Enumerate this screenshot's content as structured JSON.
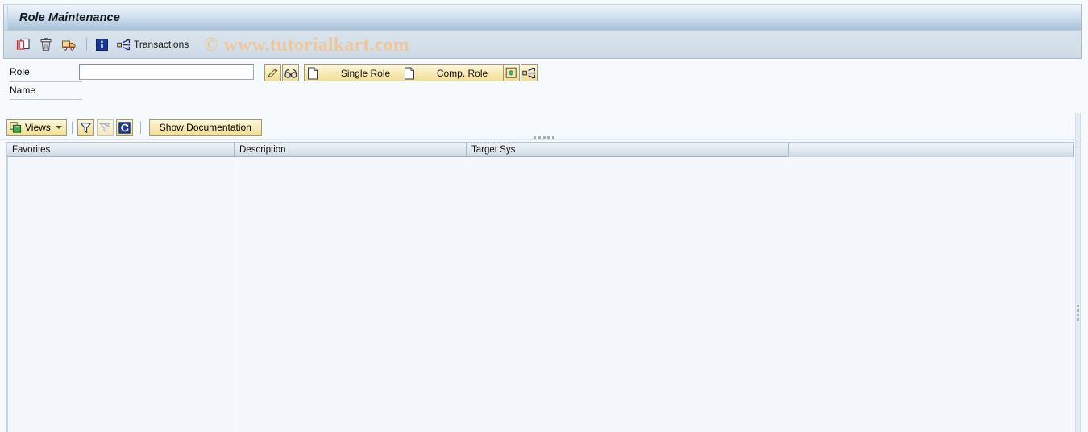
{
  "window": {
    "title": "Role Maintenance"
  },
  "watermark": {
    "text": "© www.tutorialkart.com",
    "color": "#f0c79a"
  },
  "toolbar": {
    "items": [
      {
        "name": "copy-icon",
        "label": ""
      },
      {
        "name": "delete-icon",
        "label": ""
      },
      {
        "name": "transport-icon",
        "label": ""
      },
      {
        "name": "info-icon",
        "label": ""
      },
      {
        "name": "transactions-icon",
        "label": "Transactions"
      }
    ],
    "transactions_label": "Transactions"
  },
  "entry": {
    "role_label": "Role",
    "name_label": "Name",
    "role_value": "",
    "role_placeholder": "",
    "buttons": {
      "change_label": "",
      "display_label": "",
      "single_role_label": "Single Role",
      "comp_role_label": "Comp. Role",
      "copy_role_label": "",
      "derive_label": ""
    }
  },
  "grid_toolbar": {
    "views_label": "Views",
    "filter_label": "",
    "delete_filter_label": "",
    "refresh_label": "",
    "show_documentation_label": "Show Documentation"
  },
  "grid": {
    "columns": [
      {
        "key": "favorites",
        "label": "Favorites"
      },
      {
        "key": "description",
        "label": "Description"
      },
      {
        "key": "target_sys",
        "label": "Target Sys"
      },
      {
        "key": "spare",
        "label": ""
      }
    ],
    "rows": []
  },
  "colors": {
    "title_bar_start": "#f3f8fc",
    "title_bar_end": "#a9c1d8",
    "toolbar_bg": "#d3dfe9",
    "button_yellow": "#f7ebb6",
    "grid_bg": "#f4f8fc",
    "page_bg": "#f7fafd",
    "accent_blue": "#1a3c8c"
  }
}
